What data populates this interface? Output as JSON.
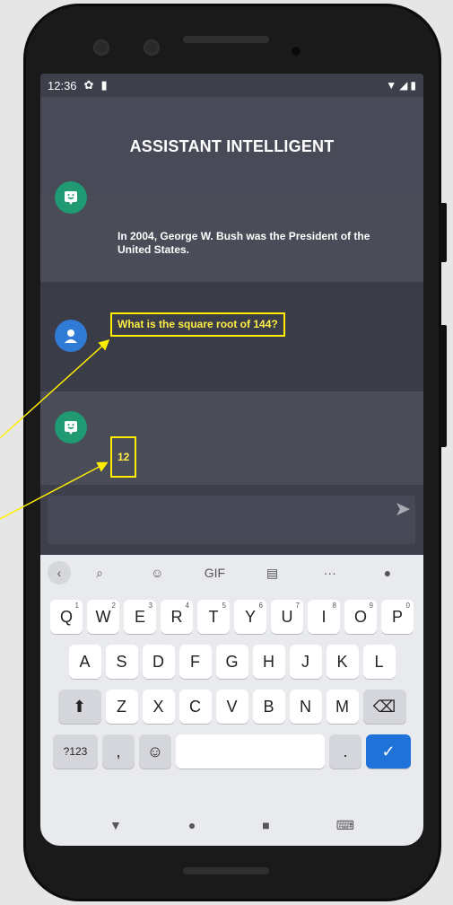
{
  "status": {
    "time": "12:36",
    "settings_icon": "gear-icon",
    "sd_icon": "sdcard-icon",
    "signal": "wifi-icon",
    "battery": "battery-icon"
  },
  "app": {
    "title": "ASSISTANT INTELLIGENT"
  },
  "messages": [
    {
      "role": "bot",
      "text": "In 2004, George W. Bush was the President of the United States."
    },
    {
      "role": "user",
      "text": "What is the square root of 144?"
    },
    {
      "role": "bot",
      "text": "12"
    }
  ],
  "input": {
    "placeholder": "",
    "send_icon": "send-icon"
  },
  "keyboard": {
    "toolbar": [
      "back",
      "search",
      "sticker",
      "GIF",
      "clipboard",
      "more",
      "mic"
    ],
    "gif_label": "GIF",
    "more_label": "···",
    "row1": [
      {
        "k": "Q",
        "n": "1"
      },
      {
        "k": "W",
        "n": "2"
      },
      {
        "k": "E",
        "n": "3"
      },
      {
        "k": "R",
        "n": "4"
      },
      {
        "k": "T",
        "n": "5"
      },
      {
        "k": "Y",
        "n": "6"
      },
      {
        "k": "U",
        "n": "7"
      },
      {
        "k": "I",
        "n": "8"
      },
      {
        "k": "O",
        "n": "9"
      },
      {
        "k": "P",
        "n": "0"
      }
    ],
    "row2": [
      "A",
      "S",
      "D",
      "F",
      "G",
      "H",
      "J",
      "K",
      "L"
    ],
    "row3": [
      "Z",
      "X",
      "C",
      "V",
      "B",
      "N",
      "M"
    ],
    "row4": {
      "sym": "?123",
      "comma": ",",
      "period": "."
    }
  },
  "colors": {
    "highlight": "#ffee00",
    "bot_avatar": "#1f9a72",
    "user_avatar": "#2f7bd6",
    "enter": "#1f73d8"
  }
}
